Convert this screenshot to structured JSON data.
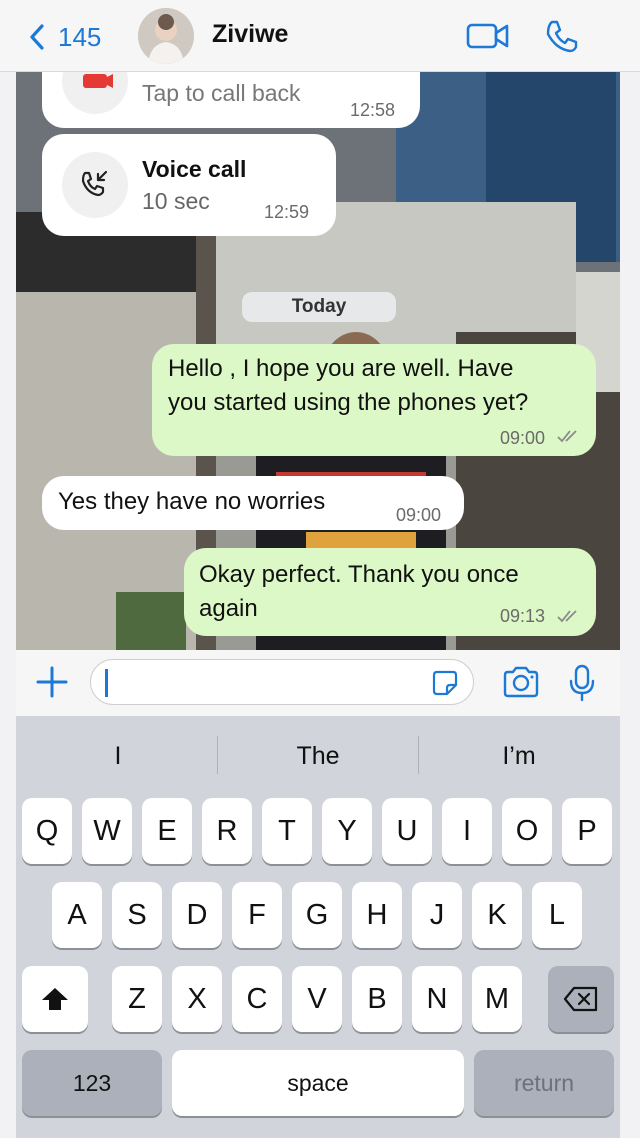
{
  "header": {
    "back_count": "145",
    "contact_name": "Ziviwe"
  },
  "messages": {
    "missed_call_hint": "Tap to call back",
    "missed_call_time": "12:58",
    "voice_call_title": "Voice call",
    "voice_call_duration": "10 sec",
    "voice_call_time": "12:59",
    "day_separator": "Today",
    "msg1_line1": "Hello , I hope you are well. Have",
    "msg1_line2": "you started using the phones yet?",
    "msg1_time": "09:00",
    "msg2_text": "Yes they have no worries",
    "msg2_time": "09:00",
    "msg3_line1": "Okay perfect. Thank you once",
    "msg3_line2": "again",
    "msg3_time": "09:13"
  },
  "keyboard": {
    "suggestions": [
      "I",
      "The",
      "I’m"
    ],
    "row1": [
      "Q",
      "W",
      "E",
      "R",
      "T",
      "Y",
      "U",
      "I",
      "O",
      "P"
    ],
    "row2": [
      "A",
      "S",
      "D",
      "F",
      "G",
      "H",
      "J",
      "K",
      "L"
    ],
    "row3": [
      "Z",
      "X",
      "C",
      "V",
      "B",
      "N",
      "M"
    ],
    "numbers_label": "123",
    "space_label": "space",
    "return_label": "return"
  },
  "colors": {
    "accent": "#1d79d6",
    "outgoing_bubble": "#dcf8c6",
    "incoming_bubble": "#ffffff",
    "missed_call": "#e53935"
  },
  "icons": {
    "back": "chevron-left-icon",
    "video": "video-camera-icon",
    "call": "phone-icon",
    "plus": "plus-icon",
    "sticker": "sticker-icon",
    "camera": "camera-icon",
    "mic": "microphone-icon",
    "shift": "shift-arrow-icon",
    "delete": "backspace-icon"
  }
}
